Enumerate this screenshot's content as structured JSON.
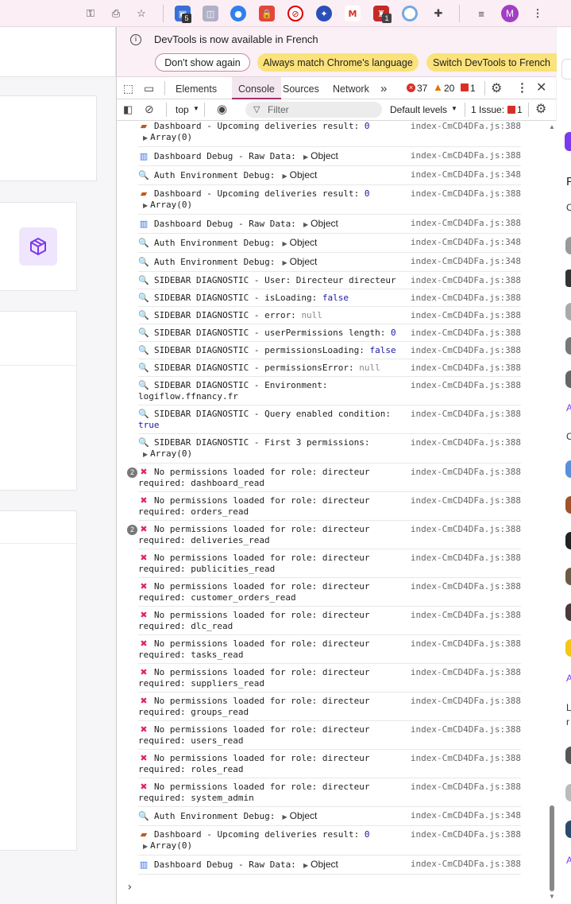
{
  "chrome": {
    "profile_initial": "M",
    "ext_badges": [
      "5",
      "1"
    ]
  },
  "infobar": {
    "message": "DevTools is now available in French",
    "btn_dont_show": "Don't show again",
    "btn_always_match": "Always match Chrome's language",
    "btn_switch": "Switch DevTools to French"
  },
  "tabs": {
    "elements": "Elements",
    "console": "Console",
    "sources": "Sources",
    "network": "Network",
    "more": "»",
    "errors": "37",
    "warnings": "20",
    "issues": "1"
  },
  "toolbar": {
    "context": "top",
    "filter_placeholder": "Filter",
    "levels": "Default levels",
    "issue_label": "1 Issue:",
    "issue_count": "1"
  },
  "console": {
    "messages": [
      {
        "icon": "truck",
        "count": "",
        "text": "Dashboard - Upcoming deliveries result: ",
        "value": "0",
        "sub": "Array(0)",
        "source": "index-CmCD4DFa.js:388"
      },
      {
        "icon": "chart",
        "count": "",
        "text": "Dashboard Debug - Raw Data: ",
        "obj": "Object",
        "source": "index-CmCD4DFa.js:388"
      },
      {
        "icon": "search",
        "count": "",
        "text": "Auth Environment Debug: ",
        "obj": "Object",
        "source": "index-CmCD4DFa.js:348"
      },
      {
        "icon": "truck",
        "count": "",
        "text": "Dashboard - Upcoming deliveries result: ",
        "value": "0",
        "sub": "Array(0)",
        "source": "index-CmCD4DFa.js:388"
      },
      {
        "icon": "chart",
        "count": "",
        "text": "Dashboard Debug - Raw Data: ",
        "obj": "Object",
        "source": "index-CmCD4DFa.js:388"
      },
      {
        "icon": "search",
        "count": "",
        "text": "Auth Environment Debug: ",
        "obj": "Object",
        "source": "index-CmCD4DFa.js:348"
      },
      {
        "icon": "search",
        "count": "",
        "text": "Auth Environment Debug: ",
        "obj": "Object",
        "source": "index-CmCD4DFa.js:348"
      },
      {
        "icon": "search",
        "count": "",
        "text": "SIDEBAR DIAGNOSTIC - User: Directeur directeur",
        "source": "index-CmCD4DFa.js:388"
      },
      {
        "icon": "search",
        "count": "",
        "text": "SIDEBAR DIAGNOSTIC - isLoading: ",
        "value": "false",
        "source": "index-CmCD4DFa.js:388"
      },
      {
        "icon": "search",
        "count": "",
        "text": "SIDEBAR DIAGNOSTIC - error: ",
        "null": "null",
        "source": "index-CmCD4DFa.js:388"
      },
      {
        "icon": "search",
        "count": "",
        "text": "SIDEBAR DIAGNOSTIC - userPermissions length: ",
        "value": "0",
        "source": "index-CmCD4DFa.js:388"
      },
      {
        "icon": "search",
        "count": "",
        "text": "SIDEBAR DIAGNOSTIC - permissionsLoading: ",
        "value": "false",
        "source": "index-CmCD4DFa.js:388"
      },
      {
        "icon": "search",
        "count": "",
        "text": "SIDEBAR DIAGNOSTIC - permissionsError: ",
        "null": "null",
        "source": "index-CmCD4DFa.js:388"
      },
      {
        "icon": "search",
        "count": "",
        "text": "SIDEBAR DIAGNOSTIC - Environment: logiflow.ffnancy.fr",
        "source": "index-CmCD4DFa.js:388"
      },
      {
        "icon": "search",
        "count": "",
        "text": "SIDEBAR DIAGNOSTIC - Query enabled condition: ",
        "value": "true",
        "source": "index-CmCD4DFa.js:388"
      },
      {
        "icon": "search",
        "count": "",
        "text": "SIDEBAR DIAGNOSTIC - First 3 permissions:",
        "sub": "Array(0)",
        "source": "index-CmCD4DFa.js:388"
      },
      {
        "icon": "x",
        "count": "2",
        "text": "No permissions loaded for role: directeur required: dashboard_read",
        "source": "index-CmCD4DFa.js:388"
      },
      {
        "icon": "x",
        "count": "",
        "text": "No permissions loaded for role: directeur required: orders_read",
        "source": "index-CmCD4DFa.js:388"
      },
      {
        "icon": "x",
        "count": "2",
        "text": "No permissions loaded for role: directeur required: deliveries_read",
        "source": "index-CmCD4DFa.js:388"
      },
      {
        "icon": "x",
        "count": "",
        "text": "No permissions loaded for role: directeur required: publicities_read",
        "source": "index-CmCD4DFa.js:388"
      },
      {
        "icon": "x",
        "count": "",
        "text": "No permissions loaded for role: directeur required: customer_orders_read",
        "source": "index-CmCD4DFa.js:388"
      },
      {
        "icon": "x",
        "count": "",
        "text": "No permissions loaded for role: directeur required: dlc_read",
        "source": "index-CmCD4DFa.js:388"
      },
      {
        "icon": "x",
        "count": "",
        "text": "No permissions loaded for role: directeur required: tasks_read",
        "source": "index-CmCD4DFa.js:388"
      },
      {
        "icon": "x",
        "count": "",
        "text": "No permissions loaded for role: directeur required: suppliers_read",
        "source": "index-CmCD4DFa.js:388"
      },
      {
        "icon": "x",
        "count": "",
        "text": "No permissions loaded for role: directeur required: groups_read",
        "source": "index-CmCD4DFa.js:388"
      },
      {
        "icon": "x",
        "count": "",
        "text": "No permissions loaded for role: directeur required: users_read",
        "source": "index-CmCD4DFa.js:388"
      },
      {
        "icon": "x",
        "count": "",
        "text": "No permissions loaded for role: directeur required: roles_read",
        "source": "index-CmCD4DFa.js:388"
      },
      {
        "icon": "x",
        "count": "",
        "text": "No permissions loaded for role: directeur required: system_admin",
        "source": "index-CmCD4DFa.js:388"
      },
      {
        "icon": "search",
        "count": "",
        "text": "Auth Environment Debug: ",
        "obj": "Object",
        "source": "index-CmCD4DFa.js:348"
      },
      {
        "icon": "truck",
        "count": "",
        "text": "Dashboard - Upcoming deliveries result: ",
        "value": "0",
        "sub": "Array(0)",
        "source": "index-CmCD4DFa.js:388"
      },
      {
        "icon": "chart",
        "count": "",
        "text": "Dashboard Debug - Raw Data: ",
        "obj": "Object",
        "source": "index-CmCD4DFa.js:388"
      }
    ],
    "prompt": "›"
  },
  "colors": {
    "accent": "#7c3aed",
    "error": "#d93025",
    "warning": "#e37400",
    "pill": "#fbe27a"
  }
}
